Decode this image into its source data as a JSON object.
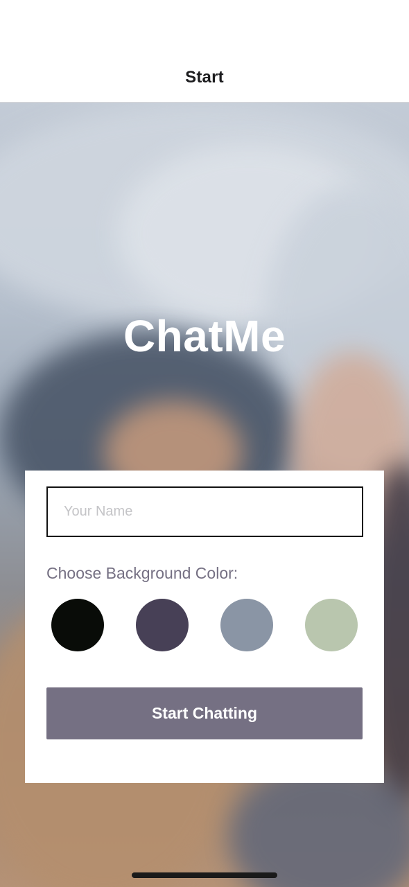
{
  "nav": {
    "title": "Start"
  },
  "app": {
    "title": "ChatMe"
  },
  "form": {
    "name_placeholder": "Your Name",
    "name_value": "",
    "color_label": "Choose Background Color:",
    "colors": [
      "#090C08",
      "#474056",
      "#8A95A5",
      "#B9C6AE"
    ],
    "start_label": "Start Chatting",
    "button_color": "#757083"
  }
}
